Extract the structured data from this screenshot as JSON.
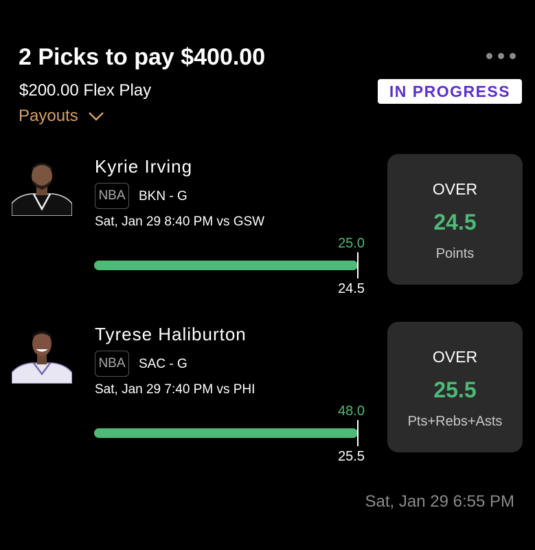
{
  "header": {
    "title": "2 Picks to pay $400.00",
    "subtitle": "$200.00 Flex Play",
    "status": "IN PROGRESS",
    "payouts_label": "Payouts"
  },
  "picks": [
    {
      "player": "Kyrie Irving",
      "league": "NBA",
      "team_pos": "BKN - G",
      "game": "Sat, Jan 29 8:40 PM vs GSW",
      "current": "25.0",
      "line": "24.5",
      "progress": 1.0,
      "direction": "OVER",
      "stat": "Points",
      "jersey_color": "#111111"
    },
    {
      "player": "Tyrese Haliburton",
      "league": "NBA",
      "team_pos": "SAC - G",
      "game": "Sat, Jan 29 7:40 PM vs PHI",
      "current": "48.0",
      "line": "25.5",
      "progress": 1.0,
      "direction": "OVER",
      "stat": "Pts+Rebs+Asts",
      "jersey_color": "#e8e6f2"
    }
  ],
  "footer": {
    "timestamp": "Sat, Jan 29 6:55 PM"
  },
  "colors": {
    "accent_green": "#4fb978",
    "payouts_orange": "#d7a06a",
    "status_purple": "#5b2fd1"
  }
}
